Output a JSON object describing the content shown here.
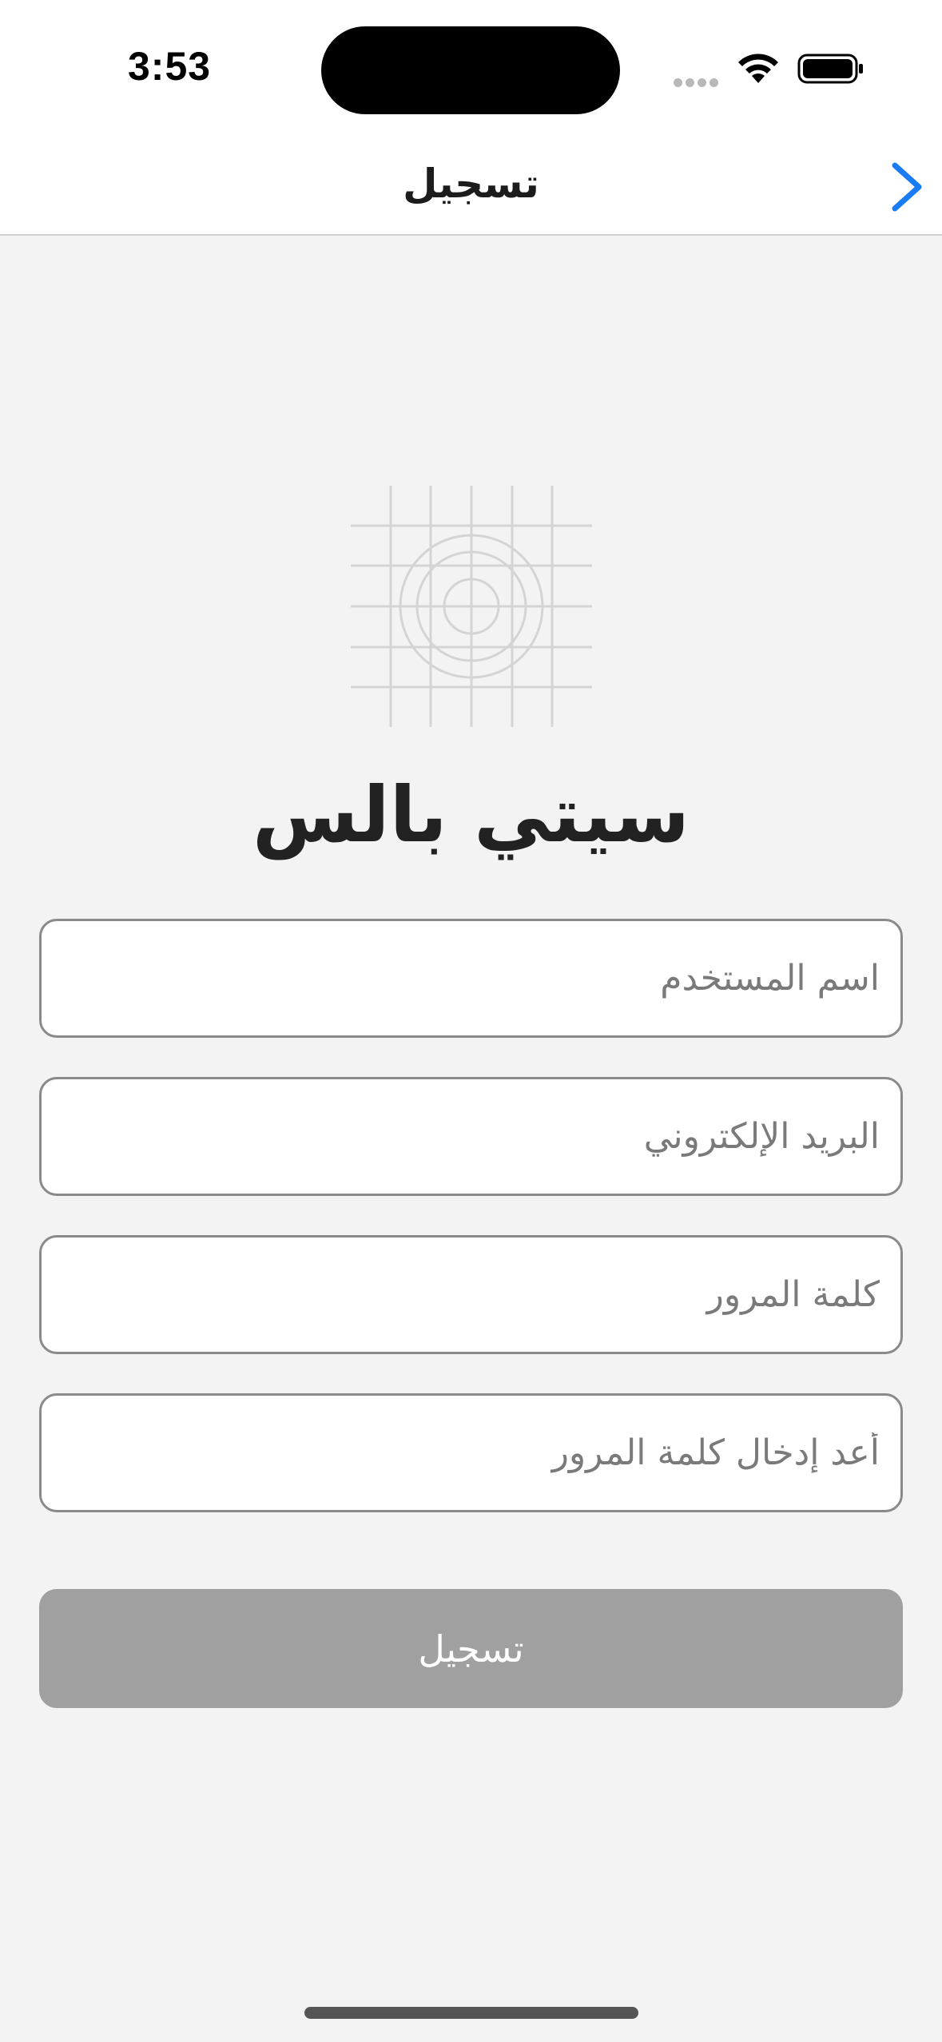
{
  "status_bar": {
    "time": "3:53"
  },
  "nav": {
    "title": "تسجيل",
    "back_icon": "chevron-right-icon",
    "accent_color": "#1a7cf5"
  },
  "logo": {
    "icon": "placeholder-image-icon"
  },
  "app_name": "سيتي بالس",
  "form": {
    "username_placeholder": "اسم المستخدم",
    "email_placeholder": "البريد الإلكتروني",
    "password_placeholder": "كلمة المرور",
    "confirm_password_placeholder": "أعد إدخال كلمة المرور",
    "submit_label": "تسجيل",
    "submit_color": "#a0a0a0"
  }
}
